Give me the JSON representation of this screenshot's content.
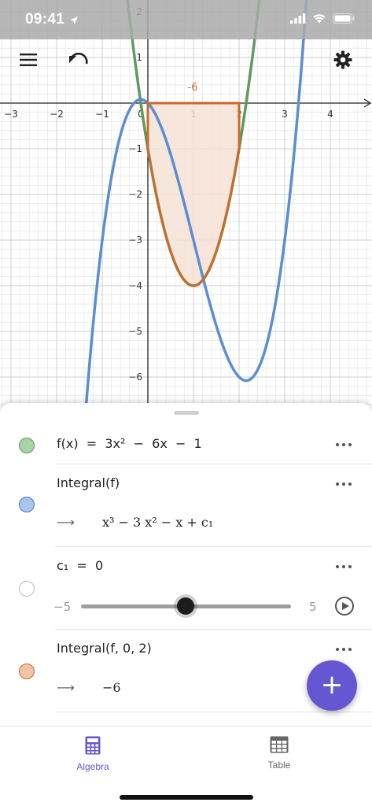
{
  "status_bar": {
    "time": "09:41"
  },
  "graph": {
    "x_ticks": [
      "−3",
      "−2",
      "−1",
      "0",
      "1",
      "2",
      "3",
      "4"
    ],
    "y_ticks": [
      "2",
      "1",
      "−1",
      "−2",
      "−3",
      "−4",
      "−5",
      "−6"
    ],
    "integral_label": "-6",
    "colors": {
      "f": "#5f9a5f",
      "integral": "#5d8fd0",
      "area": "#c96b2c",
      "area_fill": "#f6e2d6"
    }
  },
  "algebra": {
    "rows": [
      {
        "kind": "function",
        "dot_color": "#a9d3a7",
        "dot_border": "#5f9a5f",
        "expr": "f(x)  =  3x²  −  6x  −  1"
      },
      {
        "kind": "integral",
        "dot_color": "#a8c4ef",
        "dot_border": "#4b79c2",
        "expr": "Integral(f)",
        "result": "x³ − 3 x² − x + c₁"
      },
      {
        "kind": "slider",
        "dot_color": "#ffffff",
        "dot_border": "#bbbbbb",
        "expr": "c₁  =  0",
        "min": "−5",
        "max": "5",
        "value": 0
      },
      {
        "kind": "integral",
        "dot_color": "#f3c3a6",
        "dot_border": "#c96b2c",
        "expr": "Integral(f, 0, 2)",
        "result": "−6"
      }
    ]
  },
  "nav": {
    "algebra_label": "Algebra",
    "table_label": "Table"
  },
  "fab_label": "+",
  "colors": {
    "accent": "#6557d2"
  }
}
